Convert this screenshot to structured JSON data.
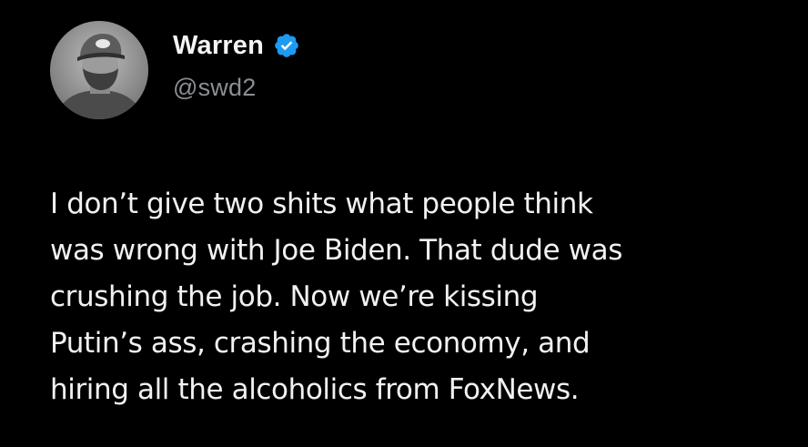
{
  "tweet": {
    "author": {
      "display_name": "Warren",
      "handle": "@swd2",
      "verified": true,
      "verified_icon": "verified-badge-icon",
      "verified_color": "#1d9bf0",
      "avatar": "profile-photo"
    },
    "text_lines": [
      "I don’t give two shits what people think",
      "was wrong with Joe Biden. That dude was",
      "crushing the job. Now we’re kissing",
      "Putin’s ass, crashing the economy, and",
      "hiring all the alcoholics from FoxNews."
    ]
  },
  "colors": {
    "background": "#000000",
    "text": "#f1f1f1",
    "handle": "#8b8f93"
  }
}
